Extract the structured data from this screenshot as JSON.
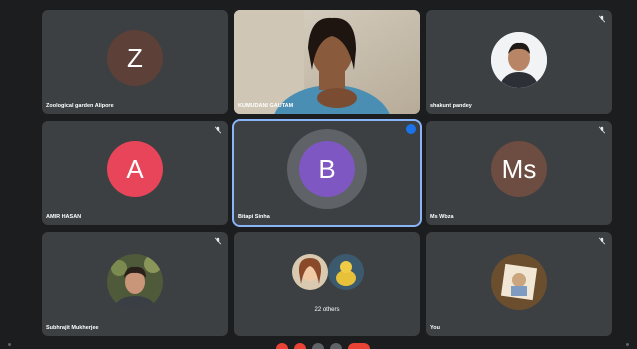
{
  "participants": [
    {
      "name": "Zoological garden Alipore",
      "initial": "Z",
      "color": "#5d4037"
    },
    {
      "name": "KUMUDANI GAUTAM"
    },
    {
      "name": "shakunt pandey"
    },
    {
      "name": "AMIR HASAN",
      "initial": "A",
      "color": "#e8455a"
    },
    {
      "name": "Bitapi Sinha",
      "initial": "B",
      "color": "#7e57c2"
    },
    {
      "name": "Ms Wbza",
      "initial": "Ms",
      "color": "#6d4c41"
    },
    {
      "name": "Subhrajit Mukherjee"
    },
    {
      "others_label": "22 others"
    },
    {
      "name": "You"
    }
  ],
  "colors": {
    "tile_bg": "#3c4043",
    "active_border": "#8ab4f8",
    "page_bg": "#1c1d1f",
    "end_call": "#ea4335"
  },
  "icons": [
    "mic-off-icon",
    "speaking-indicator-icon",
    "mic-button-icon",
    "camera-button-icon",
    "captions-button-icon",
    "more-options-icon",
    "end-call-icon"
  ]
}
